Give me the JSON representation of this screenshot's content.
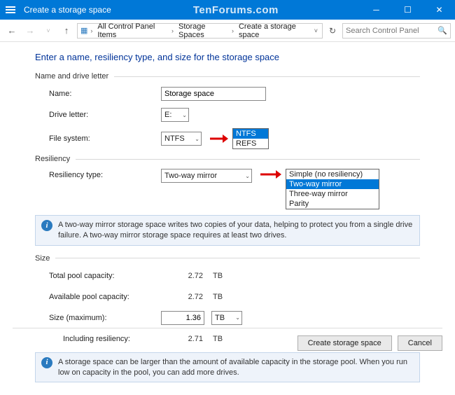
{
  "titlebar": {
    "title": "Create a storage space",
    "watermark": "TenForums.com"
  },
  "nav": {
    "crumb1": "All Control Panel Items",
    "crumb2": "Storage Spaces",
    "crumb3": "Create a storage space",
    "search_placeholder": "Search Control Panel"
  },
  "headline": "Enter a name, resiliency type, and size for the storage space",
  "sections": {
    "name_drive": "Name and drive letter",
    "resiliency": "Resiliency",
    "size": "Size"
  },
  "labels": {
    "name": "Name:",
    "drive": "Drive letter:",
    "fs": "File system:",
    "res_type": "Resiliency type:",
    "total_pool": "Total pool capacity:",
    "avail_pool": "Available pool capacity:",
    "size_max": "Size (maximum):",
    "incl_res": "Including resiliency:"
  },
  "values": {
    "name": "Storage space",
    "drive": "E:",
    "fs": "NTFS",
    "res_type": "Two-way mirror",
    "total_pool": "2.72",
    "avail_pool": "2.72",
    "size_max": "1.36",
    "incl_res": "2.71",
    "unit": "TB"
  },
  "fs_options": {
    "o1": "NTFS",
    "o2": "REFS"
  },
  "res_options": {
    "o1": "Simple (no resiliency)",
    "o2": "Two-way mirror",
    "o3": "Three-way mirror",
    "o4": "Parity"
  },
  "info": {
    "mirror": "A two-way mirror storage space writes two copies of your data, helping to protect you from a single drive failure. A two-way mirror storage space requires at least two drives.",
    "size": "A storage space can be larger than the amount of available capacity in the storage pool. When you run low on capacity in the pool, you can add more drives."
  },
  "buttons": {
    "create": "Create storage space",
    "cancel": "Cancel"
  }
}
